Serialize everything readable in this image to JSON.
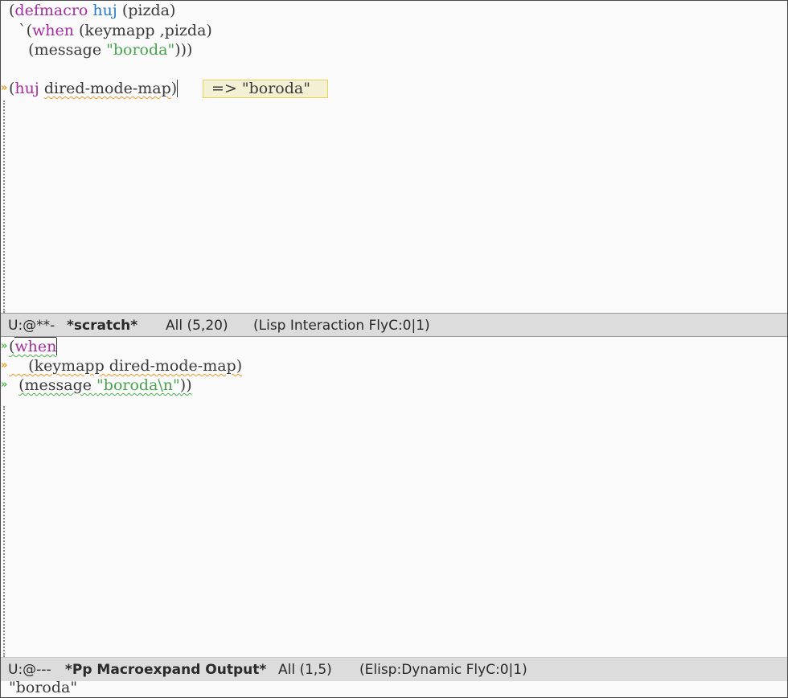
{
  "window_top": {
    "lines": [
      {
        "p1": "(",
        "kw": "defmacro",
        "sp": " ",
        "name": "huj",
        "rest": " (pizda)"
      },
      {
        "text1": "  `(",
        "kw": "when",
        "text2": " (keymapp ,pizda)"
      },
      {
        "text1": "    (message ",
        "str": "\"boroda\"",
        "text2": ")))"
      },
      {
        "open": "(",
        "fn": "huj",
        "sp": " ",
        "arg": "dired-mode-map",
        "close": ")"
      }
    ],
    "eval_result": "=> \"boroda\"",
    "fringe_arrow": "»"
  },
  "modeline_top": {
    "status": "U:@**-",
    "buffer": "*scratch*",
    "position": "All (5,20)",
    "mode": "(Lisp Interaction FlyC:0|1)"
  },
  "window_bottom": {
    "lines": [
      {
        "open": "(",
        "kw": "when"
      },
      {
        "text": "    (keymapp dired-mode-map)"
      },
      {
        "indent": "  ",
        "call": "(message ",
        "str": "\"boroda\\n\"",
        "close": "))"
      }
    ],
    "fringe_arrow": "»"
  },
  "modeline_bottom": {
    "status": "U:@---",
    "buffer": "*Pp Macroexpand Output*",
    "position": "All (1,5)",
    "mode": "(Elisp:Dynamic FlyC:0|1)"
  },
  "echo_area": "\"boroda\"",
  "colors": {
    "keyword": "#a3309e",
    "function": "#2c79c7",
    "string": "#48a34c",
    "fringe_orange": "#e59a22",
    "fringe_green": "#4bb04f"
  }
}
